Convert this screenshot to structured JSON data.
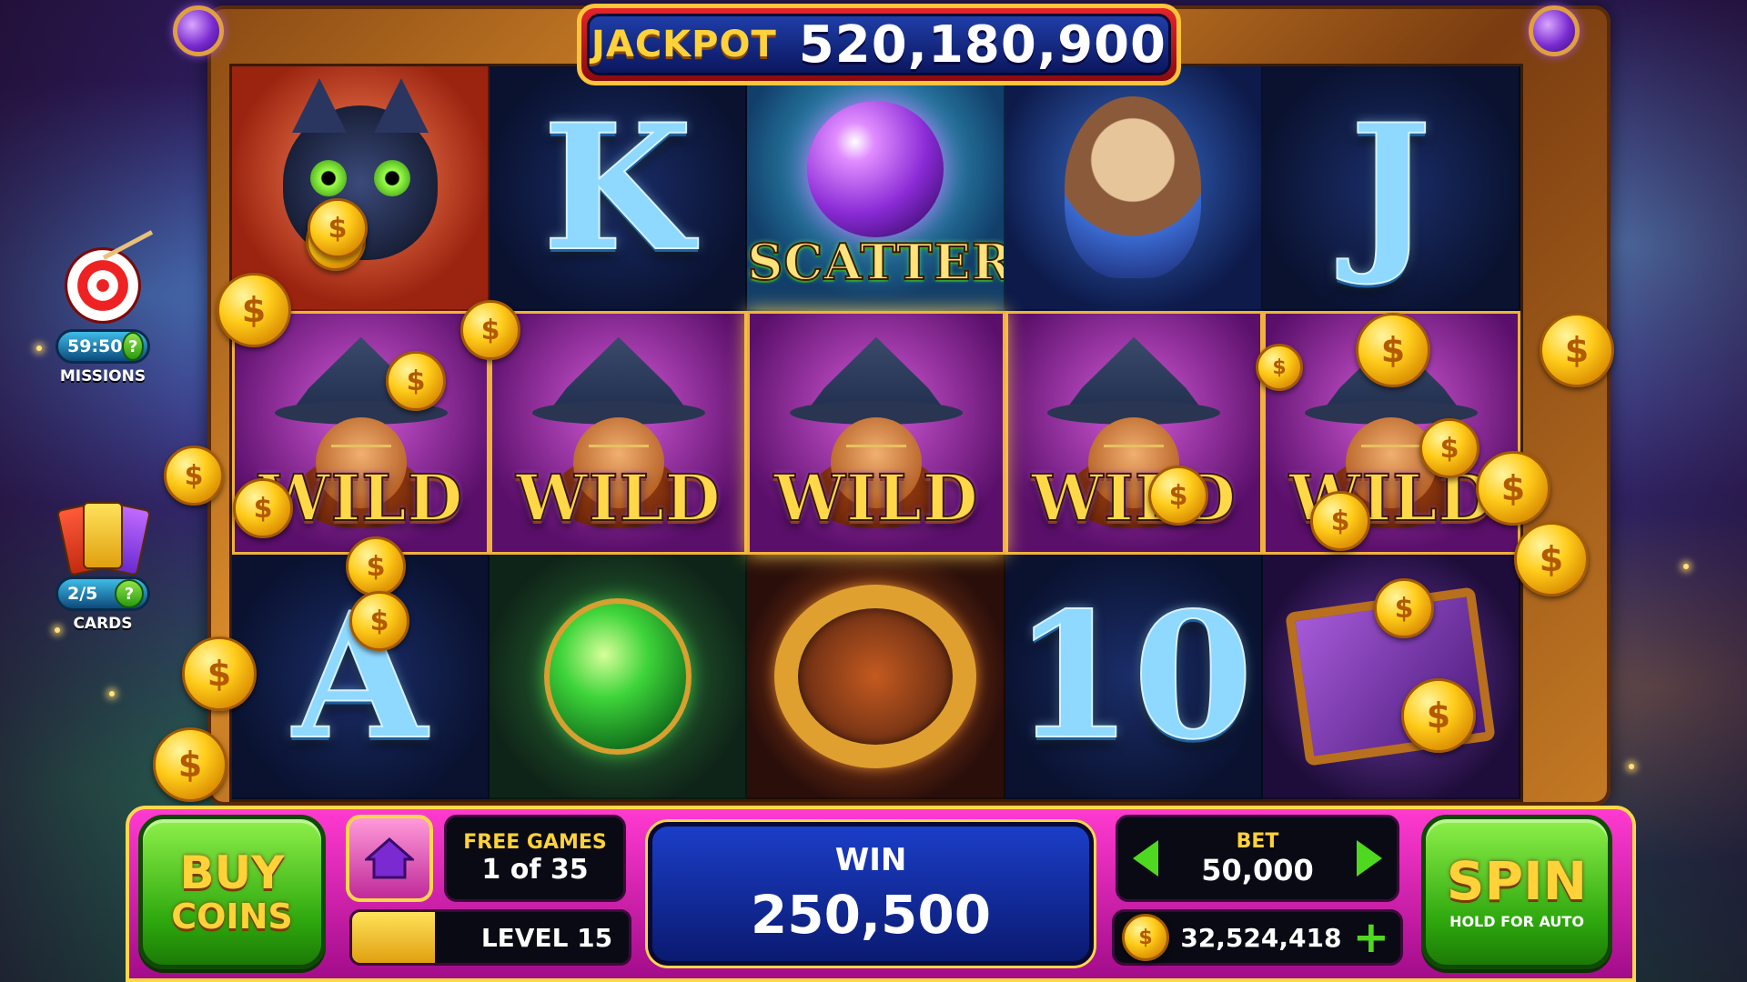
{
  "jackpot": {
    "label": "JACKPOT",
    "value": "520,180,900"
  },
  "side": {
    "missions": {
      "timer": "59:50",
      "label": "MISSIONS",
      "help": "?"
    },
    "cards": {
      "progress": "2/5",
      "label": "CARDS",
      "help": "?"
    }
  },
  "reels": {
    "row1": [
      {
        "symbol": "cat",
        "text": ""
      },
      {
        "symbol": "letter",
        "text": "K"
      },
      {
        "symbol": "scatter",
        "text": "SCATTER"
      },
      {
        "symbol": "owl",
        "text": ""
      },
      {
        "symbol": "letter",
        "text": "J"
      }
    ],
    "row2": [
      {
        "symbol": "wild",
        "text": "WILD"
      },
      {
        "symbol": "wild",
        "text": "WILD"
      },
      {
        "symbol": "wild",
        "text": "WILD"
      },
      {
        "symbol": "wild",
        "text": "WILD"
      },
      {
        "symbol": "wild",
        "text": "WILD"
      }
    ],
    "row3": [
      {
        "symbol": "letter",
        "text": "A"
      },
      {
        "symbol": "potion",
        "text": ""
      },
      {
        "symbol": "ring",
        "text": ""
      },
      {
        "symbol": "letter",
        "text": "10"
      },
      {
        "symbol": "book",
        "text": ""
      }
    ]
  },
  "coin_glyph": "$",
  "bottom": {
    "buy": {
      "line1": "BUY",
      "line2": "COINS"
    },
    "free_games": {
      "label": "FREE GAMES",
      "value": "1 of 35"
    },
    "level": {
      "label": "LEVEL 15",
      "progress_fraction": 0.3
    },
    "win": {
      "label": "WIN",
      "value": "250,500"
    },
    "bet": {
      "label": "BET",
      "value": "50,000"
    },
    "balance": {
      "value": "32,524,418",
      "plus": "+"
    },
    "spin": {
      "label": "SPIN",
      "sub": "HOLD FOR AUTO"
    }
  },
  "colors": {
    "frame": "#c47a24",
    "accent_gold": "#ffd23a",
    "button_green": "#2ea80e",
    "bar_magenta": "#ff3ad0",
    "win_blue": "#1b3ec8"
  },
  "icons": [
    "target-icon",
    "cards-icon",
    "home-icon",
    "coin-icon",
    "arrow-left-icon",
    "arrow-right-icon",
    "plus-icon",
    "question-icon"
  ]
}
